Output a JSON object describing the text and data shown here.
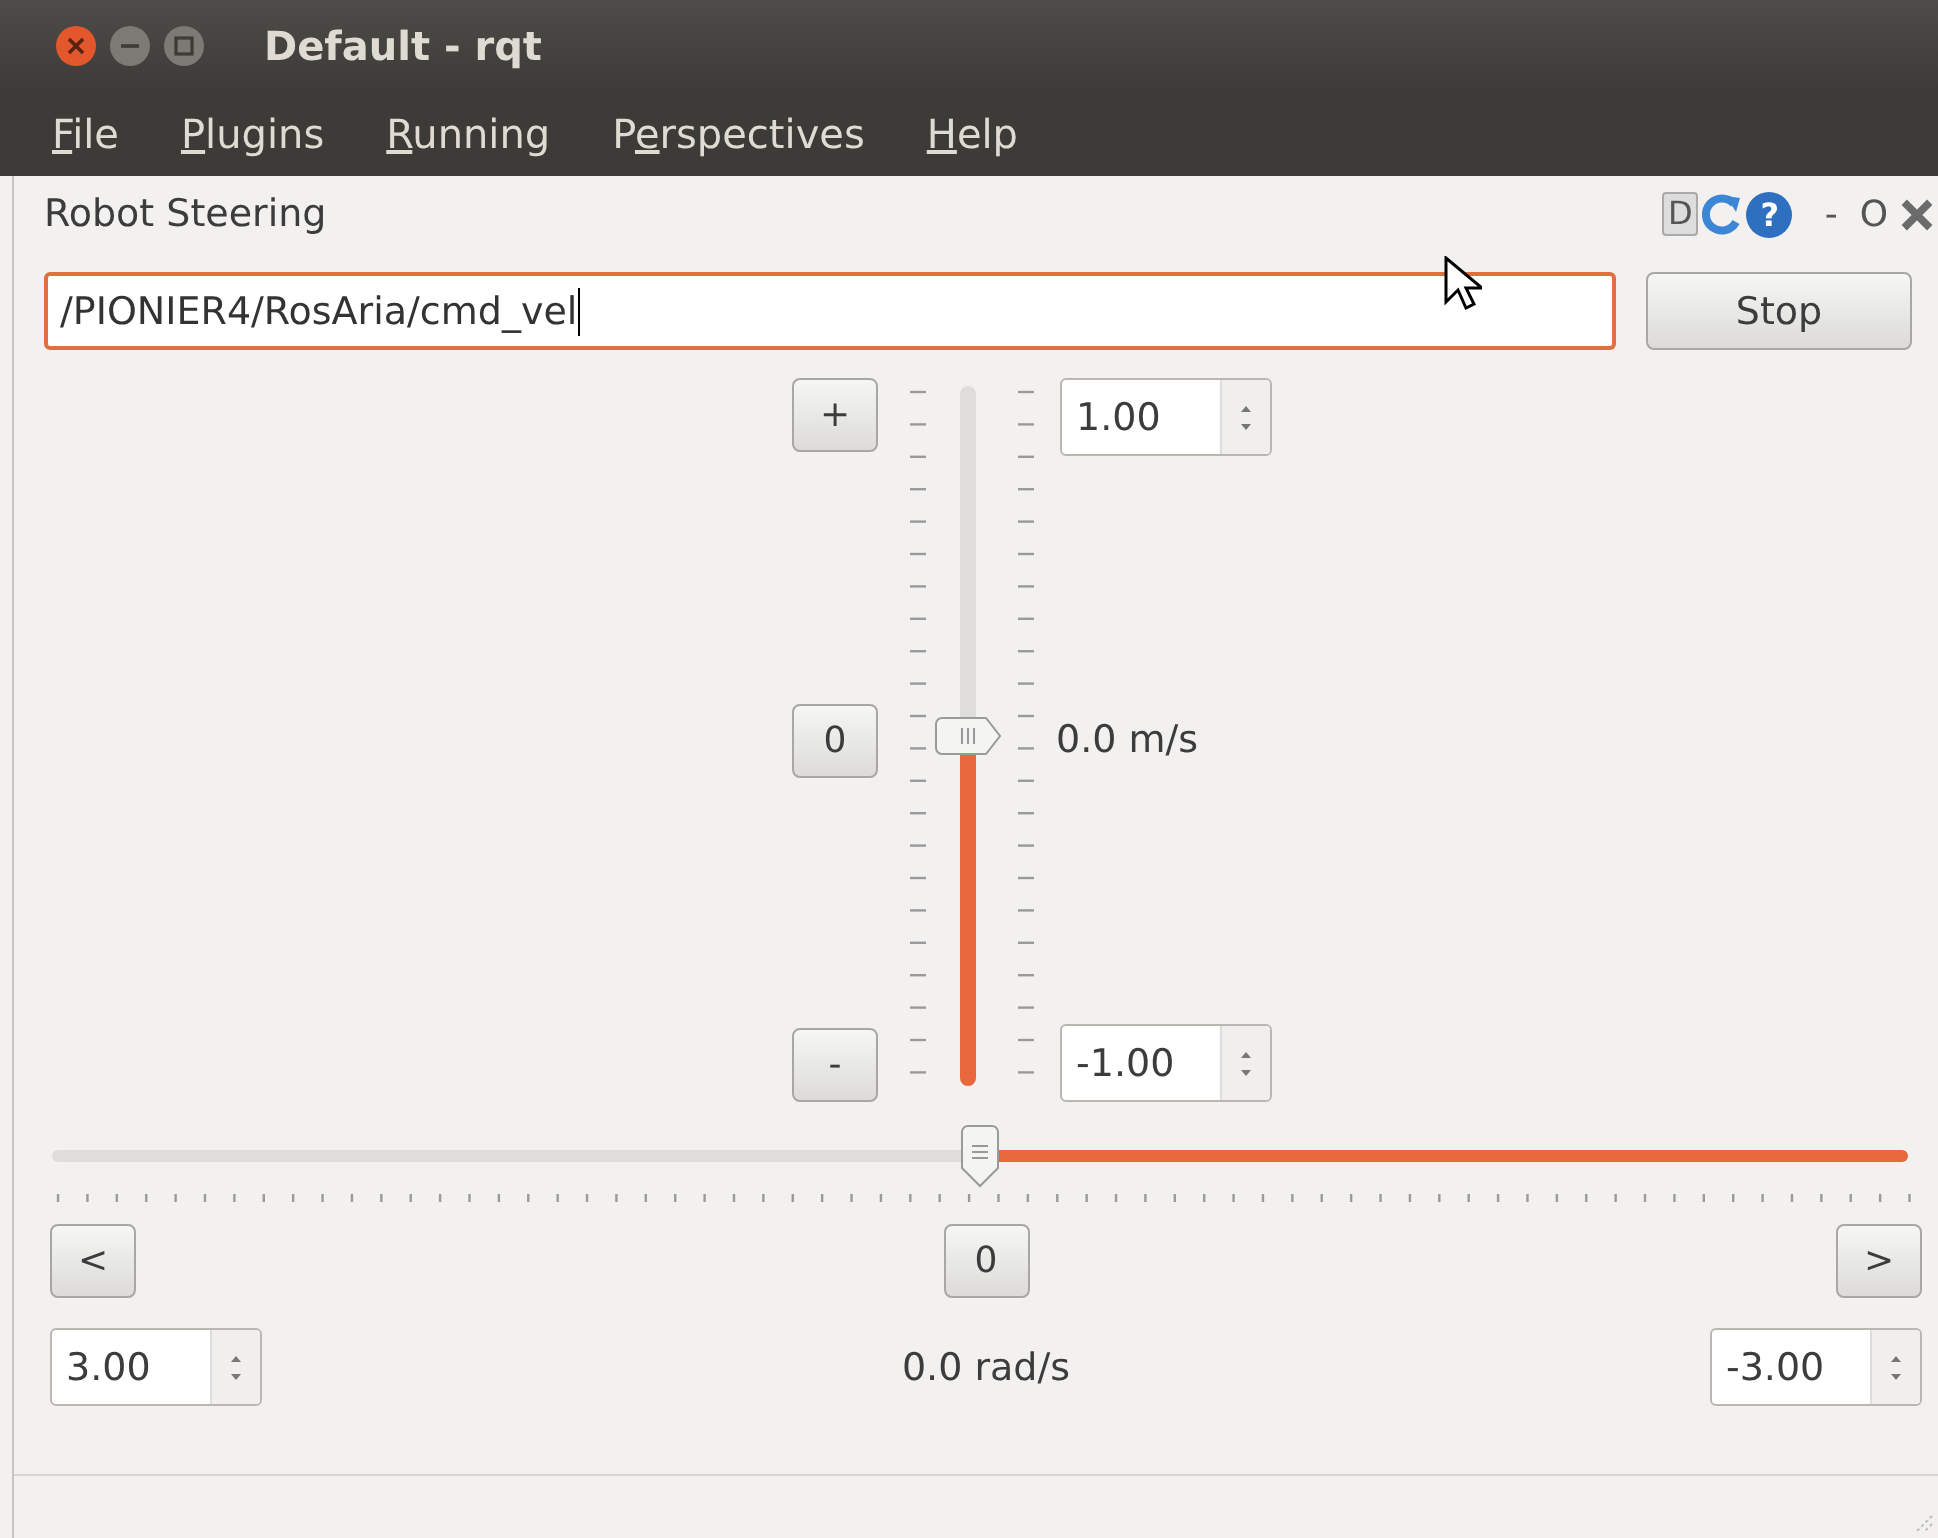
{
  "window": {
    "title": "Default - rqt"
  },
  "menu": [
    {
      "mnemonic": "F",
      "after": "ile"
    },
    {
      "mnemonic": "P",
      "after": "lugins"
    },
    {
      "mnemonic": "R",
      "after": "unning"
    },
    {
      "before": "P",
      "mnemonic": "e",
      "after": "rspectives"
    },
    {
      "mnemonic": "H",
      "after": "elp"
    }
  ],
  "plugin": {
    "title": "Robot Steering",
    "buttons": [
      {
        "kind": "text-box",
        "label": "D"
      },
      {
        "kind": "reload"
      },
      {
        "kind": "help",
        "label": "?"
      },
      {
        "kind": "text",
        "label": "-"
      },
      {
        "kind": "text",
        "label": "O"
      },
      {
        "kind": "close"
      }
    ]
  },
  "topic": {
    "value": "/PIONIER4/RosAria/cmd_vel",
    "focused": true
  },
  "stop_button": "Stop",
  "linear": {
    "buttons": [
      "+",
      "0",
      "-"
    ],
    "max": "1.00",
    "min": "-1.00",
    "reading": "0.0 m/s",
    "level": 0.5
  },
  "angular": {
    "buttons": [
      "<",
      "0",
      ">"
    ],
    "max": "3.00",
    "min": "-3.00",
    "reading": "0.0 rad/s",
    "level": 0.5
  }
}
